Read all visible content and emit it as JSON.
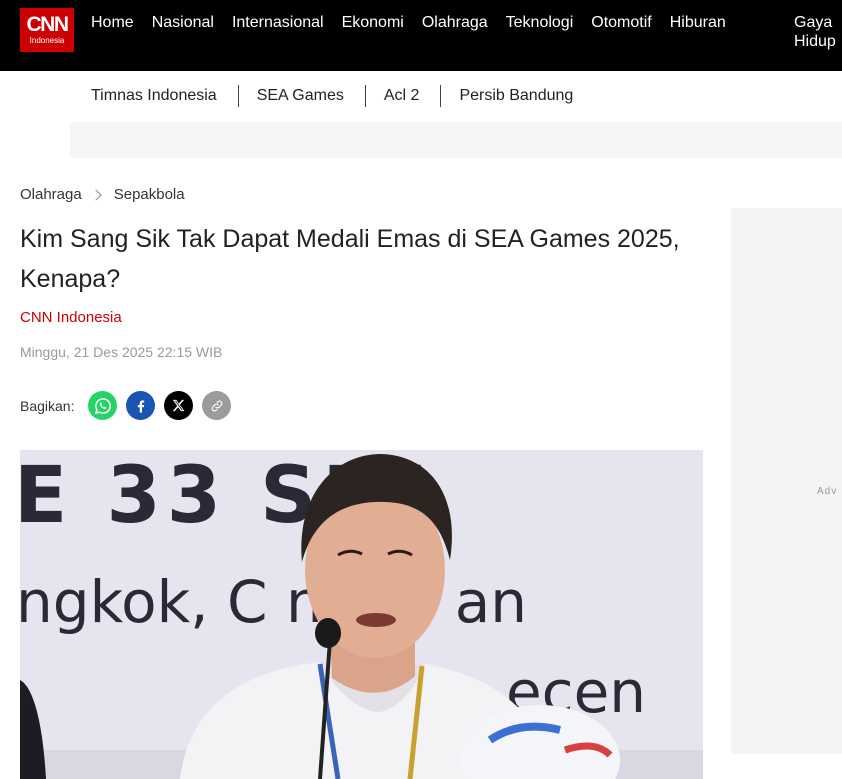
{
  "logo": {
    "brand": "CNN",
    "sub": "Indonesia"
  },
  "nav": {
    "items": [
      "Home",
      "Nasional",
      "Internasional",
      "Ekonomi",
      "Olahraga",
      "Teknologi",
      "Otomotif",
      "Hiburan"
    ],
    "last": "Gaya Hidup"
  },
  "subnav": {
    "items": [
      "Timnas Indonesia",
      "SEA Games",
      "Acl 2",
      "Persib Bandung"
    ]
  },
  "breadcrumb": {
    "items": [
      "Olahraga",
      "Sepakbola"
    ]
  },
  "article": {
    "title": "Kim Sang Sik Tak Dapat Medali Emas di SEA Games 2025, Kenapa?",
    "author": "CNN Indonesia",
    "date": "Minggu, 21 Des 2025 22:15 WIB"
  },
  "share": {
    "label": "Bagikan:",
    "buttons": [
      {
        "icon": "whatsapp-icon",
        "color": "#25d366"
      },
      {
        "icon": "facebook-icon",
        "color": "#1b55b3"
      },
      {
        "icon": "x-icon",
        "color": "#000000"
      },
      {
        "icon": "link-icon",
        "color": "#9b9b9b"
      }
    ]
  },
  "photo": {
    "backdrop_lines": [
      "E 33 SEA",
      "ngkok, C  nburi an",
      "ecen"
    ]
  },
  "ad": {
    "label": "Adv"
  },
  "colors": {
    "brand": "#cc0000",
    "topbar": "#000000"
  }
}
